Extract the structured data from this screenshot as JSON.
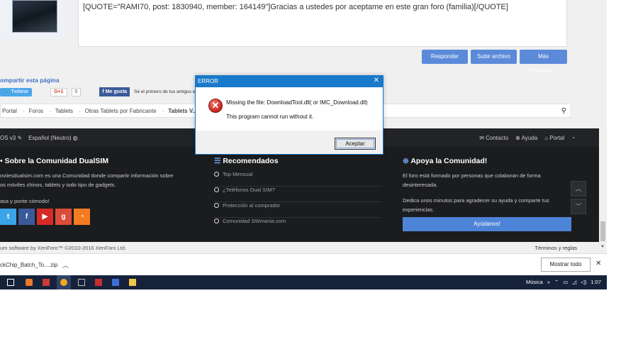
{
  "post": {
    "quote_text": "[QUOTE=\"RAMI70, post: 1830940, member: 164149\"]Gracias a ustedes por aceptame en este gran foro  (familia)[/QUOTE]"
  },
  "buttons": {
    "reply": "Responder",
    "upload": "Subir archivo",
    "more": "Más Opciones..."
  },
  "share": {
    "title": "ompartir esta página",
    "twitter": "Twittear",
    "gplus": "G+1",
    "gplus_count": "0",
    "facebook": "Me gusta",
    "fb_text": "Sé el primero de tus amigos en ..."
  },
  "breadcrumb": [
    "Portal",
    "Foros",
    "Tablets",
    "Otras Tablets por Fabricante",
    "Tablets V..."
  ],
  "footer_top": {
    "style": "OS v3",
    "language": "Español (Neutro)",
    "contact": "Contacto",
    "help": "Ayuda",
    "portal": "Portal"
  },
  "about": {
    "title": "Sobre la Comunidad DualSIM",
    "line1": "oviiesdualsim.com es una Comunidad donde compartir información sobre",
    "line2": "os móviles chinos, tablets y todo tipo de gadgets.",
    "line3": "asa y ponte cómodo!"
  },
  "recommended": {
    "title": "Recomendados",
    "items": [
      "Top Mensual",
      "¿Teléfonos Dual SIM?",
      "Protección al comprador",
      "Comunidad SWmania.com"
    ]
  },
  "support": {
    "title": "Apoya la Comunidad!",
    "line1": "El foro está formado por personas que colaboran de forma",
    "line2": "desinteresada.",
    "line3": "Dedica unos minutos para agradecer su ayuda y comparte tus",
    "line4": "experiencias.",
    "button": "Ayúdanos!"
  },
  "copyright": {
    "left": "um software by XenForo™ ©2010-2016 XenForo Ltd.",
    "right": "Términos y reglas"
  },
  "download_bar": {
    "file": "ckChip_Batch_To....zip",
    "show_all": "Mostrar todo"
  },
  "taskbar": {
    "music": "Música",
    "time": "1:07"
  },
  "dialog": {
    "title": "ERROR",
    "message1": "Missing the file: DownloadTool.dll( or IMC_Download.dll)",
    "message2": "This program cannot run without it.",
    "ok": "Aceptar"
  },
  "colors": {
    "accent": "#5b8ad9",
    "dialog_title": "#1979ca",
    "footer_bg": "#1b1c1e",
    "taskbar_bg": "#16223a"
  }
}
